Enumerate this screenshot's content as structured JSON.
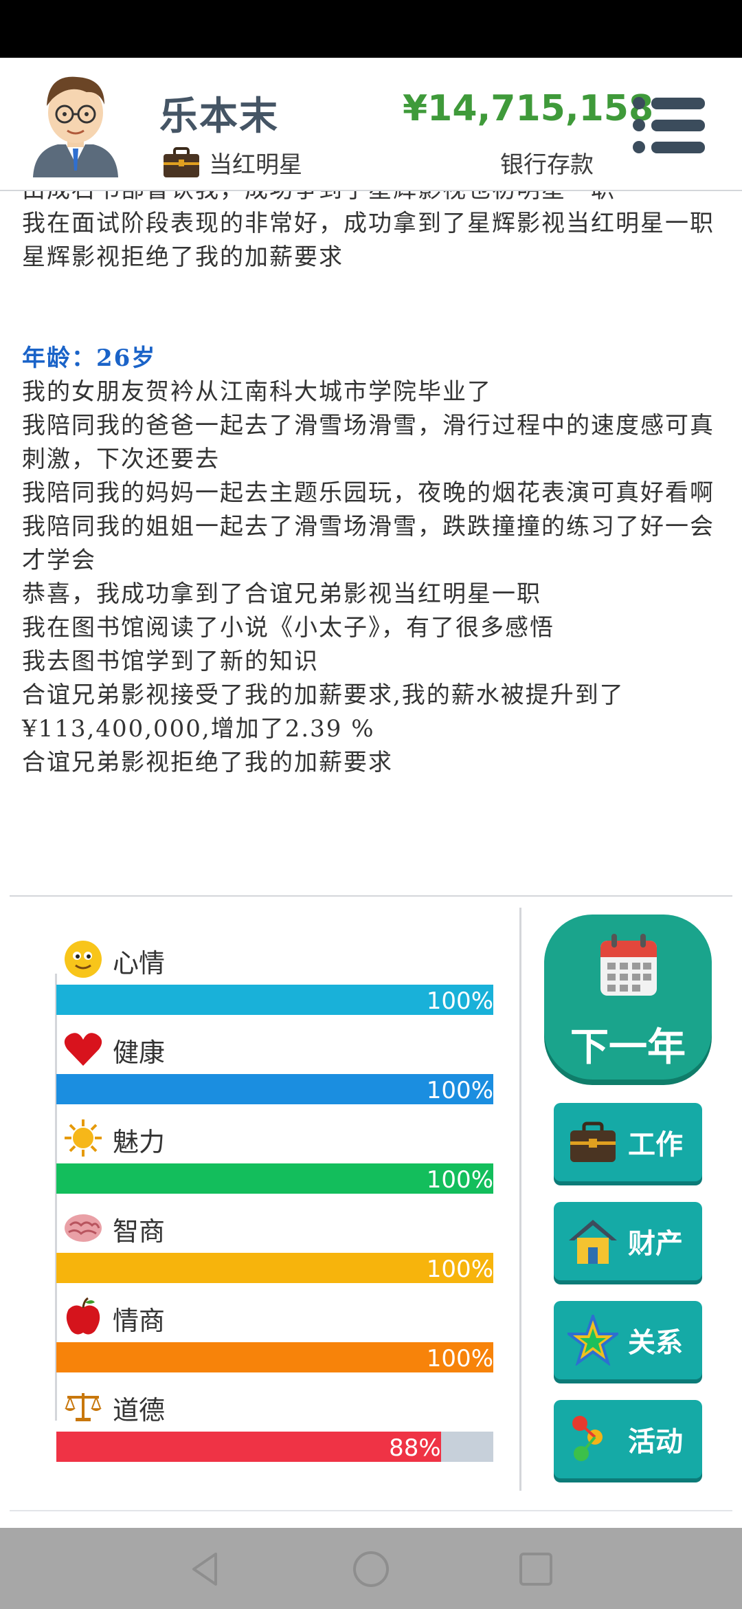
{
  "header": {
    "name": "乐本末",
    "job": "当红明星",
    "balance": "¥14,715,158",
    "balance_label": "银行存款"
  },
  "log": {
    "partial_top_line": "由成石书部曹认我，成功争到了星辉影视也初明星一职",
    "entries_before": [
      "我在面试阶段表现的非常好，成功拿到了星辉影视当红明星一职",
      "星辉影视拒绝了我的加薪要求"
    ],
    "age_heading": "年龄：26岁",
    "entries": [
      "我的女朋友贺衿从江南科大城市学院毕业了",
      "我陪同我的爸爸一起去了滑雪场滑雪，滑行过程中的速度感可真刺激，下次还要去",
      "我陪同我的妈妈一起去主题乐园玩，夜晚的烟花表演可真好看啊",
      "我陪同我的姐姐一起去了滑雪场滑雪，跌跌撞撞的练习了好一会才学会",
      "恭喜，我成功拿到了合谊兄弟影视当红明星一职",
      "我在图书馆阅读了小说《小太子》，有了很多感悟",
      "我去图书馆学到了新的知识",
      "合谊兄弟影视接受了我的加薪要求,我的薪水被提升到了¥113,400,000,增加了2.39 %",
      "合谊兄弟影视拒绝了我的加薪要求"
    ]
  },
  "stats": [
    {
      "label": "心情",
      "value": 100,
      "display": "100%",
      "color": "#19b1d9",
      "icon": "smiley-icon"
    },
    {
      "label": "健康",
      "value": 100,
      "display": "100%",
      "color": "#1b8ee0",
      "icon": "heart-icon"
    },
    {
      "label": "魅力",
      "value": 100,
      "display": "100%",
      "color": "#13be5c",
      "icon": "sun-icon"
    },
    {
      "label": "智商",
      "value": 100,
      "display": "100%",
      "color": "#f7b40c",
      "icon": "brain-icon"
    },
    {
      "label": "情商",
      "value": 100,
      "display": "100%",
      "color": "#f7830a",
      "icon": "apple-icon"
    },
    {
      "label": "道德",
      "value": 88,
      "display": "88%",
      "color": "#ef3345",
      "icon": "scales-icon"
    }
  ],
  "actions": {
    "next_year": "下一年",
    "work": "工作",
    "property": "财产",
    "relations": "关系",
    "activities": "活动"
  }
}
